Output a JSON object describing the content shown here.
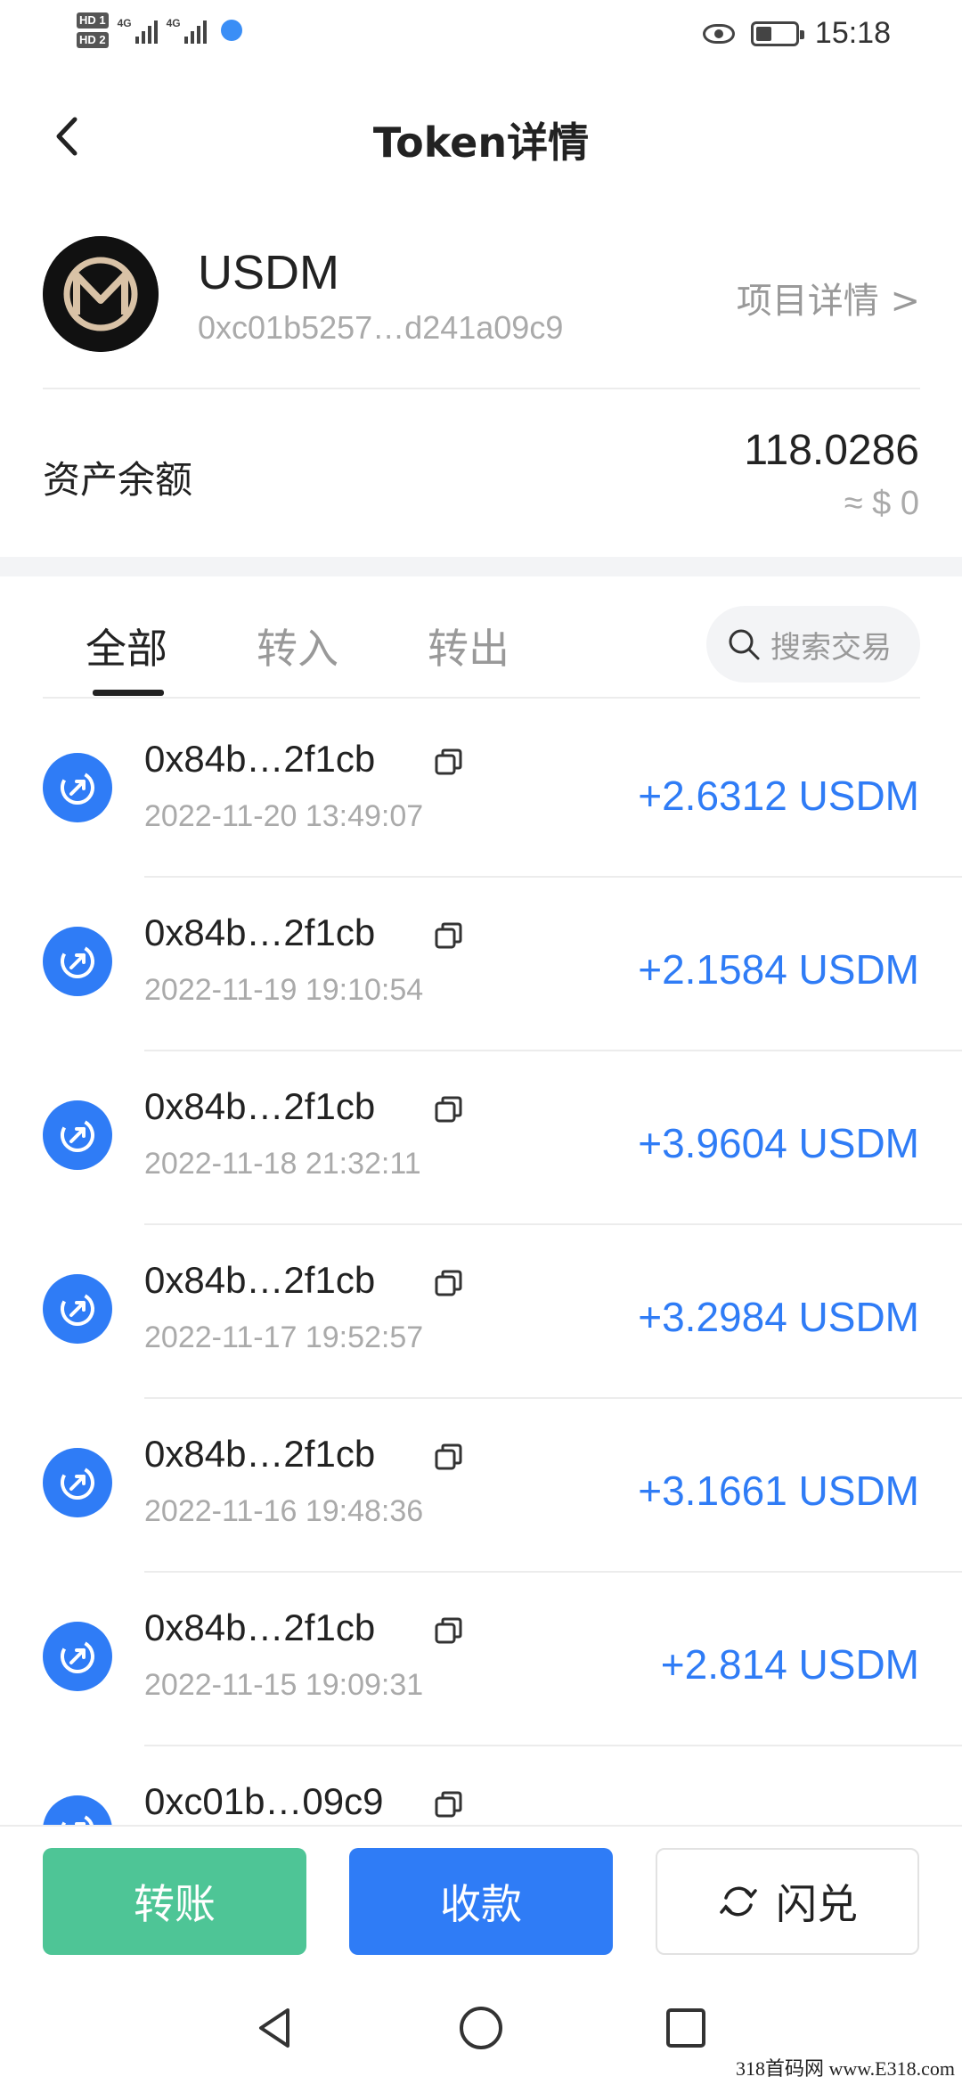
{
  "status_bar": {
    "hd1": "HD 1",
    "hd2": "HD 2",
    "network1": "4G",
    "network2": "4G",
    "time": "15:18",
    "icons": [
      "hd-badge",
      "signal-icon",
      "globe-icon",
      "eye-icon",
      "battery-icon"
    ]
  },
  "header": {
    "title": "Token详情",
    "back_icon": "chevron-left-icon"
  },
  "token": {
    "name": "USDM",
    "address": "0xc01b5257…d241a09c9",
    "project_link": "项目详情 >"
  },
  "balance": {
    "label": "资产余额",
    "value": "118.0286",
    "usd": "≈ $ 0"
  },
  "tabs": {
    "all": "全部",
    "in": "转入",
    "out": "转出",
    "active": "全部"
  },
  "search": {
    "placeholder": "搜索交易"
  },
  "transactions": [
    {
      "hash": "0x84b…2f1cb",
      "time": "2022-11-20 13:49:07",
      "amount": "+2.6312 USDM"
    },
    {
      "hash": "0x84b…2f1cb",
      "time": "2022-11-19 19:10:54",
      "amount": "+2.1584 USDM"
    },
    {
      "hash": "0x84b…2f1cb",
      "time": "2022-11-18 21:32:11",
      "amount": "+3.9604 USDM"
    },
    {
      "hash": "0x84b…2f1cb",
      "time": "2022-11-17 19:52:57",
      "amount": "+3.2984 USDM"
    },
    {
      "hash": "0x84b…2f1cb",
      "time": "2022-11-16 19:48:36",
      "amount": "+3.1661 USDM"
    },
    {
      "hash": "0x84b…2f1cb",
      "time": "2022-11-15 19:09:31",
      "amount": "+2.814 USDM"
    },
    {
      "hash": "0xc01b…09c9",
      "time": "",
      "amount": ""
    }
  ],
  "actions": {
    "transfer": "转账",
    "receive": "收款",
    "swap": "闪兑"
  },
  "watermark": "318首码网 www.E318.com",
  "colors": {
    "accent_blue": "#2f7cf6",
    "green": "#4ec596",
    "muted": "#aaaaaa"
  }
}
